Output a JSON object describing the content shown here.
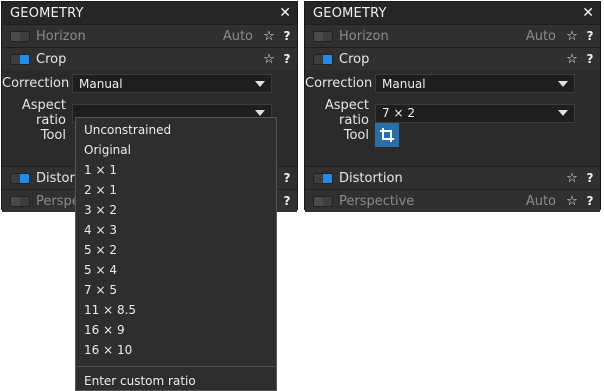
{
  "panels": [
    {
      "title": "GEOMETRY",
      "close_glyph": "✕",
      "rows": {
        "horizon": {
          "label": "Horizon",
          "auto": "Auto",
          "enabled": false
        },
        "crop": {
          "label": "Crop",
          "enabled": true
        },
        "distortion": {
          "label": "Distortion",
          "enabled": true
        },
        "perspective": {
          "label": "Perspective",
          "enabled": false
        }
      },
      "fields": {
        "correction_label": "Correction",
        "correction_value": "Manual",
        "aspect_label": "Aspect ratio",
        "aspect_value": "",
        "tool_label": "Tool"
      }
    },
    {
      "title": "GEOMETRY",
      "close_glyph": "✕",
      "rows": {
        "horizon": {
          "label": "Horizon",
          "auto": "Auto",
          "enabled": false
        },
        "crop": {
          "label": "Crop",
          "enabled": true
        },
        "distortion": {
          "label": "Distortion",
          "enabled": true
        },
        "perspective": {
          "label": "Perspective",
          "auto": "Auto",
          "enabled": false
        }
      },
      "fields": {
        "correction_label": "Correction",
        "correction_value": "Manual",
        "aspect_label": "Aspect ratio",
        "aspect_value": "7 × 2",
        "tool_label": "Tool"
      }
    }
  ],
  "icons": {
    "star": "☆",
    "help": "?"
  },
  "dropdown": {
    "options": [
      "Unconstrained",
      "Original",
      "1 × 1",
      "2 × 1",
      "3 × 2",
      "4 × 3",
      "5 × 2",
      "5 × 4",
      "7 × 5",
      "11 × 8.5",
      "16 × 9",
      "16 × 10"
    ],
    "custom_option": "Enter custom ratio"
  },
  "colors": {
    "accent": "#1d8ef0",
    "tool_button": "#2a6ea8",
    "panel_bg": "#2b2b2b"
  }
}
